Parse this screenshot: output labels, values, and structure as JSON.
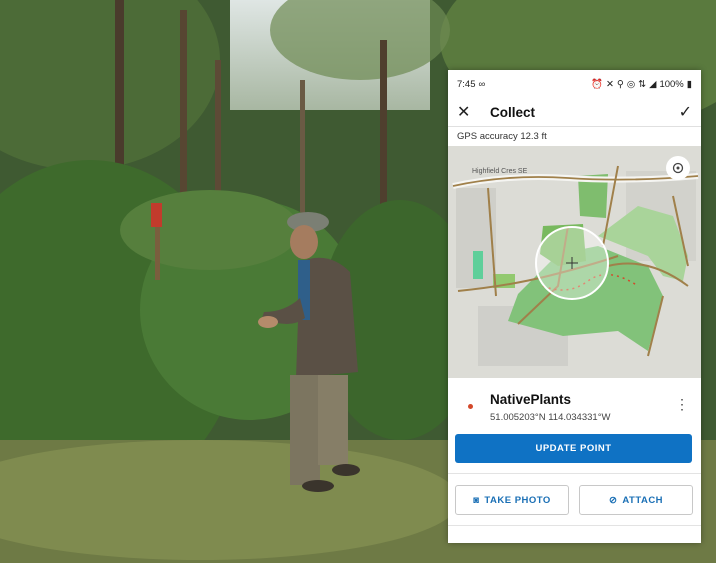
{
  "status_bar": {
    "time": "7:45",
    "battery": "100%",
    "icons": [
      "voicemail-icon",
      "alarm-icon",
      "mute-icon",
      "location-icon",
      "hotspot-icon",
      "lte-icon",
      "signal-icon",
      "battery-icon"
    ]
  },
  "app_bar": {
    "title": "Collect"
  },
  "gps_accuracy": "GPS accuracy 12.3 ft",
  "map": {
    "street_label": "Highfield Cres SE"
  },
  "feature": {
    "name": "NativePlants",
    "coordinates": "51.005203°N  114.034331°W"
  },
  "buttons": {
    "update_point": "UPDATE POINT",
    "take_photo": "TAKE PHOTO",
    "attach": "ATTACH"
  },
  "colors": {
    "accent": "#0f72c4",
    "button_text": "#1a6fb5",
    "feature_dot": "#d3482a"
  }
}
